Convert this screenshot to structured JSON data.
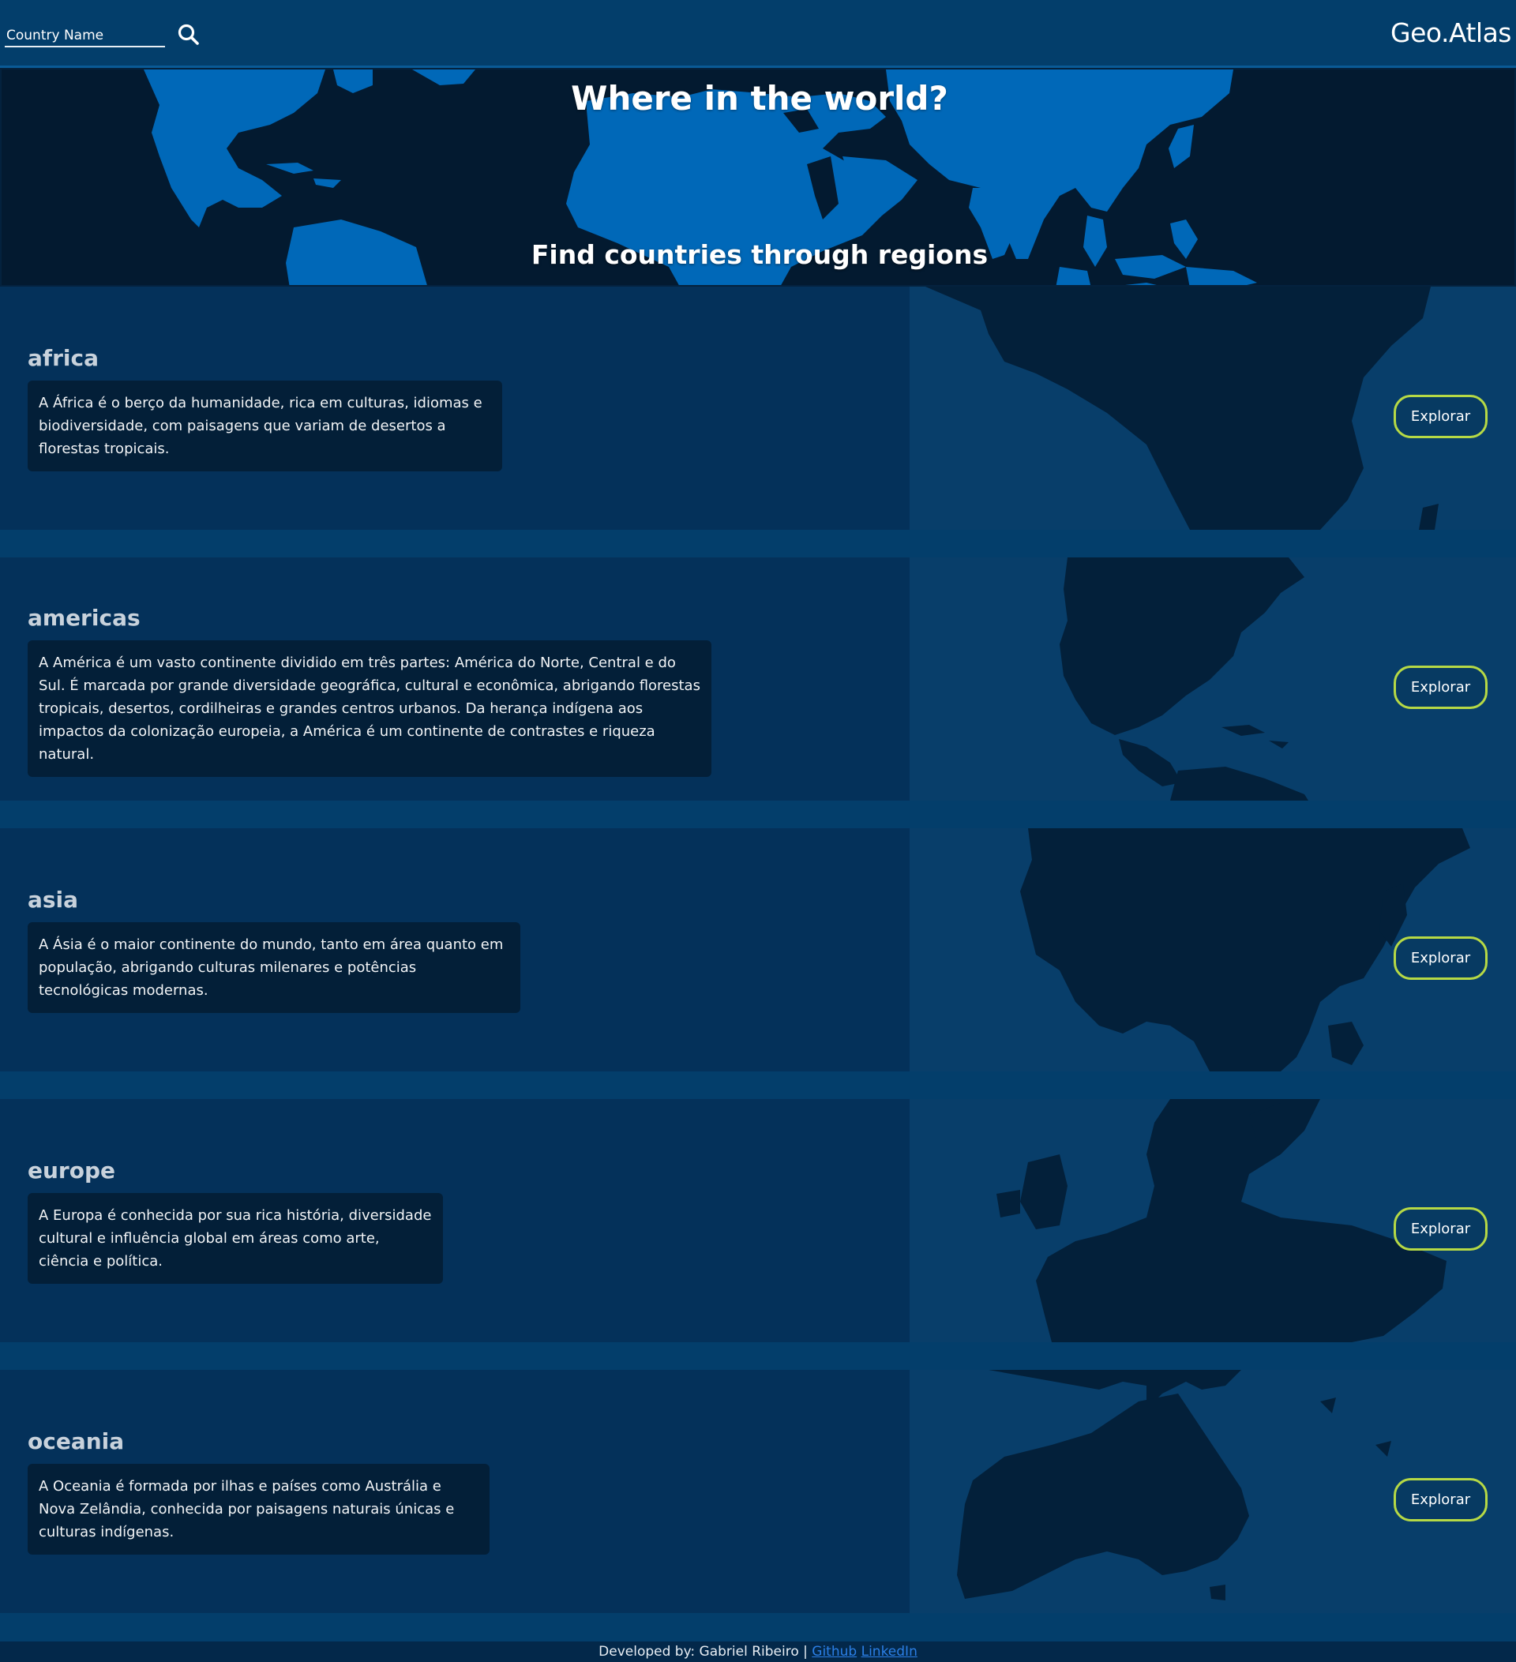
{
  "header": {
    "search_placeholder": "Country Name",
    "search_icon": "search-icon",
    "brand": "Geo.Atlas"
  },
  "hero": {
    "title": "Where in the world?",
    "subtitle": "Find countries through regions"
  },
  "regions": [
    {
      "name": "africa",
      "description": "A África é o berço da humanidade, rica em culturas, idiomas e biodiversidade, com paisagens que variam de desertos a florestas tropicais.",
      "button": "Explorar"
    },
    {
      "name": "americas",
      "description": "A América é um vasto continente dividido em três partes: América do Norte, Central e do Sul. É marcada por grande diversidade geográfica, cultural e econômica, abrigando florestas tropicais, desertos, cordilheiras e grandes centros urbanos. Da herança indígena aos impactos da colonização europeia, a América é um continente de contrastes e riqueza natural.",
      "button": "Explorar"
    },
    {
      "name": "asia",
      "description": "A Ásia é o maior continente do mundo, tanto em área quanto em população, abrigando culturas milenares e potências tecnológicas modernas.",
      "button": "Explorar"
    },
    {
      "name": "europe",
      "description": "A Europa é conhecida por sua rica história, diversidade cultural e influência global em áreas como arte, ciência e política.",
      "button": "Explorar"
    },
    {
      "name": "oceania",
      "description": "A Oceania é formada por ilhas e países como Austrália e Nova Zelândia, conhecida por paisagens naturais únicas e culturas indígenas.",
      "button": "Explorar"
    }
  ],
  "footer": {
    "credit": "Developed by: Gabriel Ribeiro | ",
    "github": "Github",
    "linkedin": "LinkedIn"
  },
  "colors": {
    "background": "#033e6b",
    "hero_background": "#031a30",
    "land": "#0068b8",
    "card": "#04315a",
    "card_text_box": "#031f38",
    "button_border": "#b6d945",
    "link": "#2b7fe6"
  }
}
